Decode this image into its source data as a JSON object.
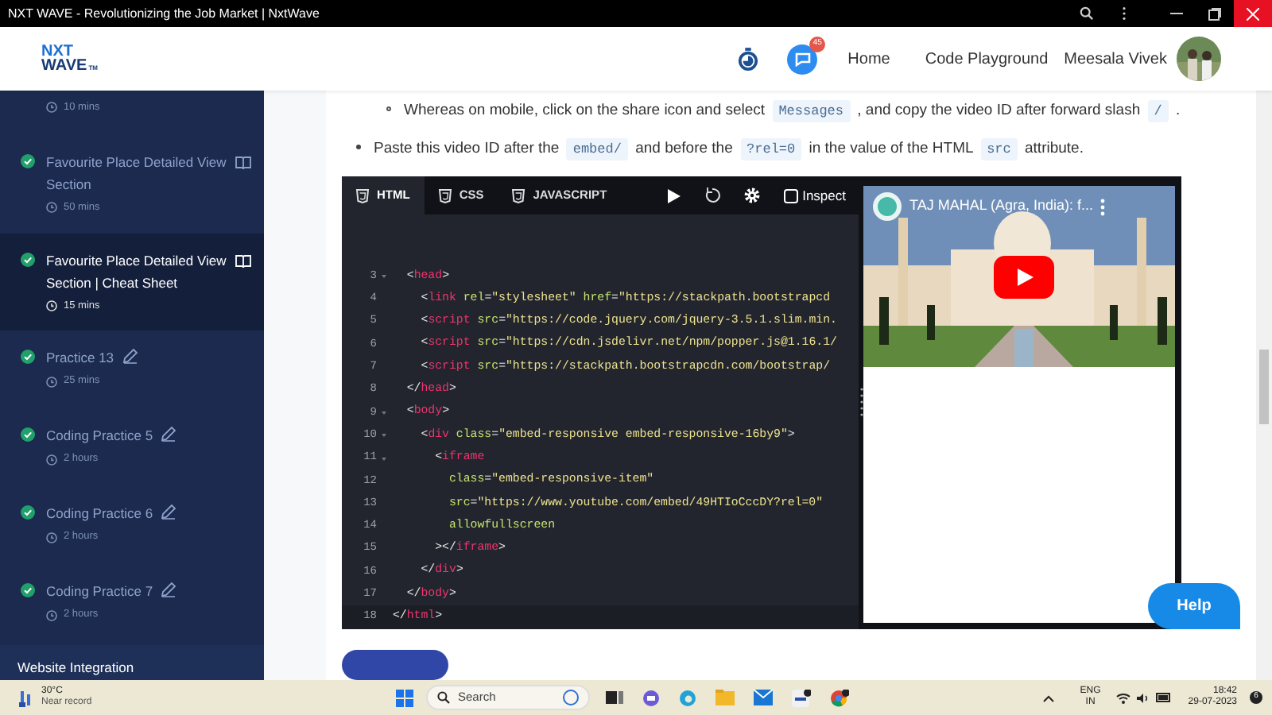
{
  "window": {
    "title": "NXT WAVE - Revolutionizing the Job Market | NxtWave"
  },
  "header": {
    "logo": {
      "line1": "NXT",
      "line2": "WAVE",
      "mark": "TM"
    },
    "notification_count": "45",
    "nav": [
      "Home",
      "Code Playground"
    ],
    "user_name": "Meesala Vivek"
  },
  "sidebar": {
    "items": [
      {
        "kind": "tail",
        "duration": "10 mins",
        "selected": false
      },
      {
        "kind": "reading",
        "title": "Favourite Place Detailed View Section",
        "duration": "50 mins",
        "selected": false,
        "completed": true
      },
      {
        "kind": "reading",
        "title": "Favourite Place Detailed View Section | Cheat Sheet",
        "duration": "15 mins",
        "selected": true,
        "completed": true
      },
      {
        "kind": "practice",
        "title": "Practice 13",
        "duration": "25 mins",
        "selected": false,
        "completed": true
      },
      {
        "kind": "practice",
        "title": "Coding Practice 5",
        "duration": "2 hours",
        "selected": false,
        "completed": true
      },
      {
        "kind": "practice",
        "title": "Coding Practice 6",
        "duration": "2 hours",
        "selected": false,
        "completed": true
      },
      {
        "kind": "practice",
        "title": "Coding Practice 7",
        "duration": "2 hours",
        "selected": false,
        "completed": true
      }
    ],
    "next_section": "Website Integration"
  },
  "content": {
    "items": [
      {
        "children": [
          {
            "segments": [
              {
                "kind": "text",
                "text": "Whereas on mobile, click on the share icon and select "
              },
              {
                "kind": "code",
                "text": "Messages"
              },
              {
                "kind": "text",
                "text": " , and copy the video ID after forward slash "
              },
              {
                "kind": "code",
                "text": "/"
              },
              {
                "kind": "text",
                "text": " ."
              }
            ]
          }
        ]
      },
      {
        "segments": [
          {
            "kind": "text",
            "text": "Paste this video ID after the "
          },
          {
            "kind": "code",
            "text": "embed/"
          },
          {
            "kind": "text",
            "text": " and before the "
          },
          {
            "kind": "code",
            "text": "?rel=0"
          },
          {
            "kind": "text",
            "text": " in the value of the HTML "
          },
          {
            "kind": "code",
            "text": "src"
          },
          {
            "kind": "text",
            "text": " attribute."
          }
        ]
      }
    ]
  },
  "editor": {
    "tabs": [
      {
        "label": "HTML",
        "selected": true
      },
      {
        "label": "CSS",
        "selected": false
      },
      {
        "label": "JAVASCRIPT",
        "selected": false
      }
    ],
    "inspect": {
      "label": "Inspect",
      "checked": false
    },
    "lines": [
      {
        "number": "3",
        "fold": true,
        "tokens": [
          {
            "kind": "punct",
            "text": "  <"
          },
          {
            "kind": "tag",
            "text": "head"
          },
          {
            "kind": "punct",
            "text": ">"
          }
        ]
      },
      {
        "number": "4",
        "fold": false,
        "tokens": [
          {
            "kind": "punct",
            "text": "    <"
          },
          {
            "kind": "tag",
            "text": "link"
          },
          {
            "kind": "attr",
            "text": " rel"
          },
          {
            "kind": "punct",
            "text": "="
          },
          {
            "kind": "str",
            "text": "\"stylesheet\""
          },
          {
            "kind": "attr",
            "text": " href"
          },
          {
            "kind": "punct",
            "text": "="
          },
          {
            "kind": "str",
            "text": "\"https://stackpath.bootstrapcd"
          }
        ]
      },
      {
        "number": "5",
        "fold": false,
        "tokens": [
          {
            "kind": "punct",
            "text": "    <"
          },
          {
            "kind": "tag",
            "text": "script"
          },
          {
            "kind": "attr",
            "text": " src"
          },
          {
            "kind": "punct",
            "text": "="
          },
          {
            "kind": "str",
            "text": "\"https://code.jquery.com/jquery-3.5.1.slim.min."
          }
        ]
      },
      {
        "number": "6",
        "fold": false,
        "tokens": [
          {
            "kind": "punct",
            "text": "    <"
          },
          {
            "kind": "tag",
            "text": "script"
          },
          {
            "kind": "attr",
            "text": " src"
          },
          {
            "kind": "punct",
            "text": "="
          },
          {
            "kind": "str",
            "text": "\"https://cdn.jsdelivr.net/npm/popper.js@1.16.1/"
          }
        ]
      },
      {
        "number": "7",
        "fold": false,
        "tokens": [
          {
            "kind": "punct",
            "text": "    <"
          },
          {
            "kind": "tag",
            "text": "script"
          },
          {
            "kind": "attr",
            "text": " src"
          },
          {
            "kind": "punct",
            "text": "="
          },
          {
            "kind": "str",
            "text": "\"https://stackpath.bootstrapcdn.com/bootstrap/"
          }
        ]
      },
      {
        "number": "8",
        "fold": false,
        "tokens": [
          {
            "kind": "punct",
            "text": "  </"
          },
          {
            "kind": "tag",
            "text": "head"
          },
          {
            "kind": "punct",
            "text": ">"
          }
        ]
      },
      {
        "number": "9",
        "fold": true,
        "tokens": [
          {
            "kind": "punct",
            "text": "  <"
          },
          {
            "kind": "tag",
            "text": "body"
          },
          {
            "kind": "punct",
            "text": ">"
          }
        ]
      },
      {
        "number": "10",
        "fold": true,
        "tokens": [
          {
            "kind": "punct",
            "text": "    <"
          },
          {
            "kind": "tag",
            "text": "div"
          },
          {
            "kind": "attr",
            "text": " class"
          },
          {
            "kind": "punct",
            "text": "="
          },
          {
            "kind": "str",
            "text": "\"embed-responsive embed-responsive-16by9\""
          },
          {
            "kind": "punct",
            "text": ">"
          }
        ]
      },
      {
        "number": "11",
        "fold": true,
        "tokens": [
          {
            "kind": "punct",
            "text": "      <"
          },
          {
            "kind": "tag",
            "text": "iframe"
          }
        ]
      },
      {
        "number": "12",
        "fold": false,
        "tokens": [
          {
            "kind": "attr",
            "text": "        class"
          },
          {
            "kind": "punct",
            "text": "="
          },
          {
            "kind": "str",
            "text": "\"embed-responsive-item\""
          }
        ]
      },
      {
        "number": "13",
        "fold": false,
        "tokens": [
          {
            "kind": "attr",
            "text": "        src"
          },
          {
            "kind": "punct",
            "text": "="
          },
          {
            "kind": "str",
            "text": "\"https://www.youtube.com/embed/49HTIoCccDY?rel=0\""
          }
        ]
      },
      {
        "number": "14",
        "fold": false,
        "tokens": [
          {
            "kind": "attr",
            "text": "        allowfullscreen"
          }
        ]
      },
      {
        "number": "15",
        "fold": false,
        "tokens": [
          {
            "kind": "punct",
            "text": "      ></"
          },
          {
            "kind": "tag",
            "text": "iframe"
          },
          {
            "kind": "punct",
            "text": ">"
          }
        ]
      },
      {
        "number": "16",
        "fold": false,
        "tokens": [
          {
            "kind": "punct",
            "text": "    </"
          },
          {
            "kind": "tag",
            "text": "div"
          },
          {
            "kind": "punct",
            "text": ">"
          }
        ]
      },
      {
        "number": "17",
        "fold": false,
        "tokens": [
          {
            "kind": "punct",
            "text": "  </"
          },
          {
            "kind": "tag",
            "text": "body"
          },
          {
            "kind": "punct",
            "text": ">"
          }
        ]
      },
      {
        "number": "18",
        "fold": false,
        "tokens": [
          {
            "kind": "punct",
            "text": "</"
          },
          {
            "kind": "tag",
            "text": "html"
          },
          {
            "kind": "punct",
            "text": ">"
          }
        ]
      }
    ],
    "video": {
      "title": "TAJ MAHAL (Agra, India): f..."
    }
  },
  "help_button": "Help",
  "taskbar": {
    "weather": {
      "temp": "30°C",
      "note": "Near record"
    },
    "search_placeholder": "Search",
    "language": "ENG",
    "region": "IN",
    "time": "18:42",
    "date": "29-07-2023",
    "notification_count": "6"
  }
}
